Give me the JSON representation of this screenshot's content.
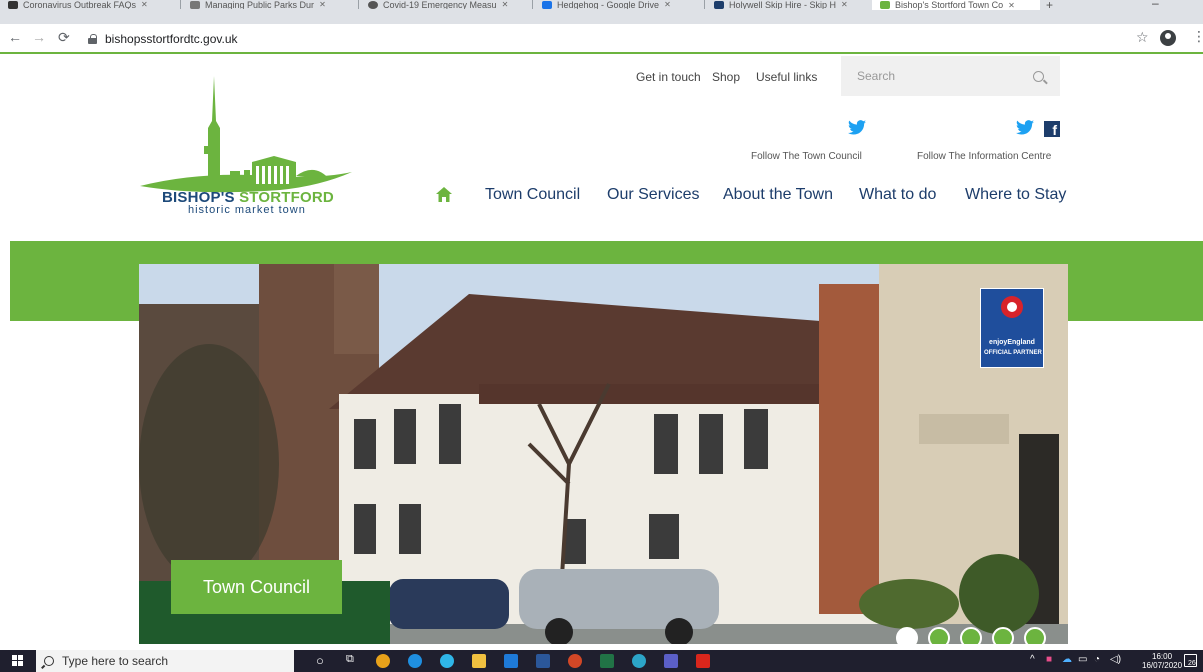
{
  "browser": {
    "tabs": [
      {
        "label": "Coronavirus Outbreak FAQs",
        "favicon_color": "#333333"
      },
      {
        "label": "Managing Public Parks Dur",
        "favicon_color": "#777777"
      },
      {
        "label": "Covid-19 Emergency Measu",
        "favicon_color": "#555555"
      },
      {
        "label": "Hedgehog - Google Drive",
        "favicon_color": "#1a73e8"
      },
      {
        "label": "Holywell Skip Hire - Skip H",
        "favicon_color": "#1d3d6b"
      },
      {
        "label": "Bishop's Stortford Town Co",
        "favicon_color": "#6cb43f"
      }
    ],
    "url": "bishopsstortfordtc.gov.uk"
  },
  "header": {
    "top_links": [
      "Get in touch",
      "Shop",
      "Useful links"
    ],
    "search_placeholder": "Search",
    "follow_town_council": "Follow The Town Council",
    "follow_information_centre": "Follow The Information Centre",
    "logo_title_a": "BISHOP'S",
    "logo_title_b": "STORTFORD",
    "logo_subtitle": "historic market town"
  },
  "nav": {
    "items": [
      "Town Council",
      "Our Services",
      "About the Town",
      "What to do",
      "Where to Stay"
    ]
  },
  "hero": {
    "caption": "Town Council",
    "badge_line1": "enjoyEngland",
    "badge_line2": "OFFICIAL PARTNER",
    "slides_total": 5,
    "active_slide": 1
  },
  "taskbar": {
    "search_placeholder": "Type here to search",
    "time": "16:00",
    "date": "16/07/2020",
    "notification_count": "26"
  },
  "colors": {
    "brand_green": "#6cb43f",
    "brand_navy": "#1d3d6b",
    "caption_dark_green": "#1f5a2c",
    "twitter_blue": "#1da1f2"
  }
}
